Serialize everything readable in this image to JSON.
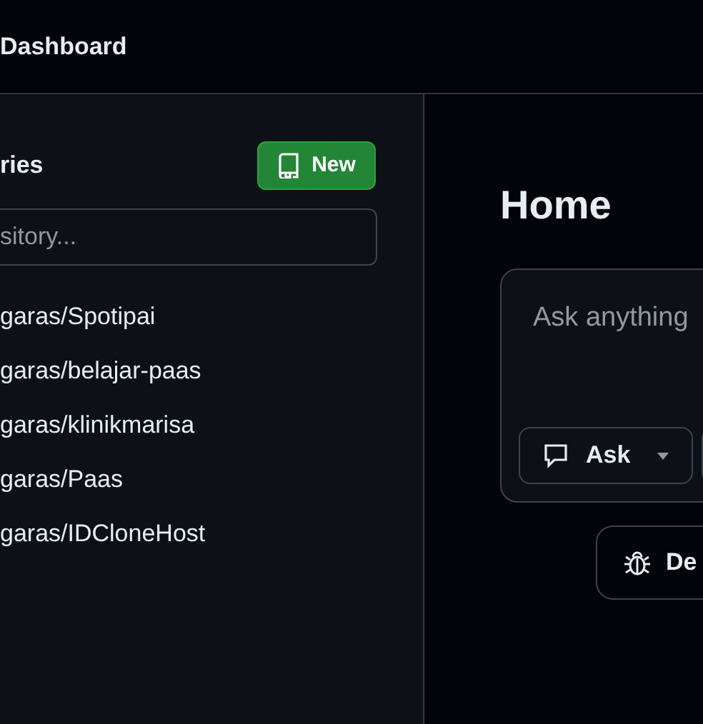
{
  "header": {
    "title": "Dashboard"
  },
  "sidebar": {
    "heading": "ries",
    "new_button": "New",
    "search": {
      "placeholder": "sitory..."
    },
    "repositories": [
      "garas/Spotipai",
      "garas/belajar-paas",
      "garas/klinikmarisa",
      "garas/Paas",
      "garas/IDCloneHost"
    ]
  },
  "main": {
    "title": "Home",
    "ask_box": {
      "placeholder": "Ask anything"
    },
    "mode_button": "Ask",
    "action_button": "De"
  }
}
